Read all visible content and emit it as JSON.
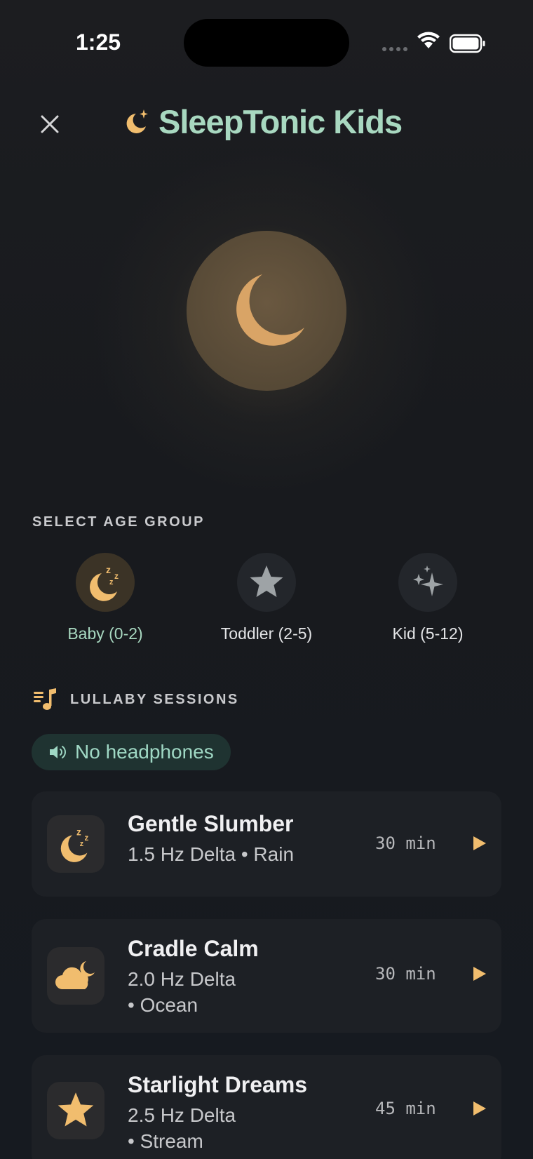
{
  "status_bar": {
    "time": "1:25"
  },
  "header": {
    "title": "SleepTonic Kids"
  },
  "age_section": {
    "label": "SELECT AGE GROUP",
    "groups": [
      {
        "label": "Baby (0-2)",
        "icon": "moon-zzz-icon",
        "selected": true
      },
      {
        "label": "Toddler (2-5)",
        "icon": "star-icon",
        "selected": false
      },
      {
        "label": "Kid (5-12)",
        "icon": "sparkles-icon",
        "selected": false
      }
    ]
  },
  "sessions": {
    "label": "LULLABY SESSIONS",
    "headphones_chip": "No headphones",
    "items": [
      {
        "title": "Gentle Slumber",
        "line1": "1.5 Hz Delta • Rain",
        "line2": "",
        "duration": "30 min",
        "icon": "moon-zzz-icon"
      },
      {
        "title": "Cradle Calm",
        "line1": "2.0 Hz Delta",
        "line2": "• Ocean",
        "duration": "30 min",
        "icon": "cloud-moon-icon"
      },
      {
        "title": "Starlight Dreams",
        "line1": "2.5 Hz Delta",
        "line2": "• Stream",
        "duration": "45 min",
        "icon": "star-icon"
      }
    ]
  },
  "colors": {
    "accent_gold": "#f1bd6e",
    "accent_mint": "#a8d8c0",
    "background": "#171a1f"
  }
}
